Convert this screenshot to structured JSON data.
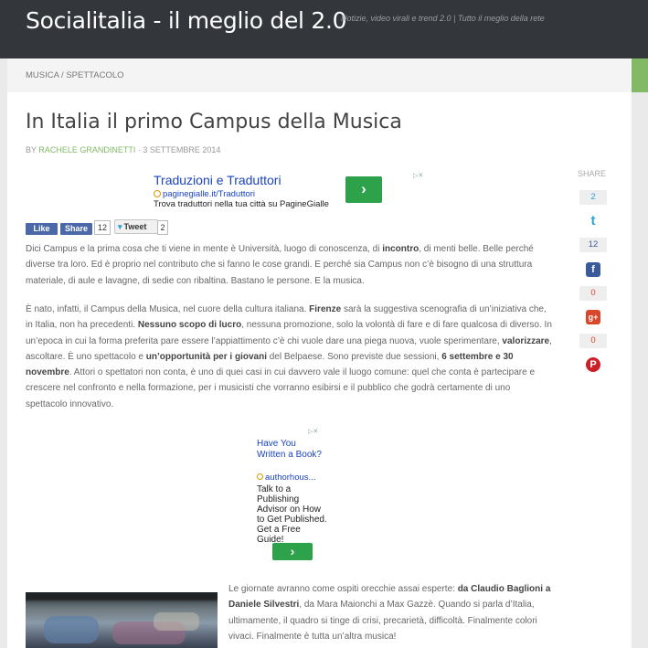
{
  "header": {
    "site_title": "Socialitalia - il meglio del 2.0",
    "tagline": "Notizie, video virali e trend 2.0 | Tutto il meglio della rete"
  },
  "breadcrumb": "MUSICA / SPETTACOLO",
  "post": {
    "title": "In Italia il primo Campus della Musica",
    "by_prefix": "BY",
    "author": "RACHELE GRANDINETTI",
    "date": "3 SETTEMBRE 2014"
  },
  "ad_top": {
    "title": "Traduzioni e Traduttori",
    "url": "paginegialle.it/Traduttori",
    "desc": "Trova traduttori nella tua città su PagineGialle",
    "button": "›"
  },
  "social": {
    "fb_like": "Like",
    "fb_share": "Share",
    "fb_count": "12",
    "tweet": "Tweet",
    "tweet_count": "2"
  },
  "paragraphs": [
    {
      "segments": [
        {
          "t": "Dici Campus e la prima cosa che ti viene in mente è Università, luogo di conoscenza, di "
        },
        {
          "t": "incontro",
          "b": true
        },
        {
          "t": ", di menti belle. Belle perché diverse tra loro. Ed è proprio nel contributo che si fanno le cose grandi. E perché sia Campus non c’è bisogno di una struttura materiale, di aule e lavagne, di sedie con ribaltina. Bastano le persone. E la musica."
        }
      ]
    },
    {
      "segments": [
        {
          "t": "È nato, infatti, il Campus della Musica, nel cuore della cultura italiana. "
        },
        {
          "t": "Firenze",
          "b": true
        },
        {
          "t": " sarà la suggestiva scenografia di un’iniziativa che, in Italia, non ha precedenti. "
        },
        {
          "t": "Nessuno scopo di lucro",
          "b": true
        },
        {
          "t": ", nessuna promozione, solo la volontà di fare e di fare qualcosa di diverso. In un’epoca in cui la forma preferita pare essere l’appiattimento c’è chi vuole dare una piega nuova, vuole sperimentare, "
        },
        {
          "t": "valorizzare",
          "b": true
        },
        {
          "t": ", ascoltare. È uno spettacolo e "
        },
        {
          "t": "un’opportunità per i giovani",
          "b": true
        },
        {
          "t": " del Belpaese. Sono previste due sessioni, "
        },
        {
          "t": "6 settembre e 30 novembre",
          "b": true
        },
        {
          "t": ". Attori o spettatori non conta, è uno di quei casi in cui davvero vale il luogo comune: quel che conta è partecipare e crescere nel confronto e nella formazione, per i musicisti che vorranno esibirsi e il pubblico che godrà certamente di uno spettacolo innovativo."
        }
      ]
    },
    {
      "segments": [
        {
          "t": "Le giornate avranno come ospiti orecchie assai esperte: "
        },
        {
          "t": "da Claudio Baglioni a Daniele Silvestri",
          "b": true
        },
        {
          "t": ", da Mara Maionchi a Max Gazzè. Quando si parla d’Italia, ultimamente, il quadro si tinge di crisi, precarietà, difficoltà. Finalmente colori vivaci. Finalmente è tutta un’altra musica!"
        }
      ]
    }
  ],
  "ad_side": {
    "title": "Have You Written a Book?",
    "url": "authorhous...",
    "desc": "Talk to a Publishing Advisor on How to Get Published. Get a Free Guide!",
    "button": "›"
  },
  "share": {
    "label": "SHARE",
    "items": [
      {
        "name": "twitter",
        "count": "2",
        "color": "#2aa3d8",
        "glyph": "t"
      },
      {
        "name": "facebook",
        "count": "12",
        "color": "#3b5a9a",
        "glyph": "f"
      },
      {
        "name": "googleplus",
        "count": "0",
        "color": "#d9472b",
        "glyph": "g+"
      },
      {
        "name": "pinterest",
        "count": "0",
        "color": "#cb2027",
        "glyph": "P"
      }
    ]
  },
  "colors": {
    "accent_green": "#82b965",
    "header_bg": "#33363b",
    "link_blue": "#1a44c2"
  }
}
